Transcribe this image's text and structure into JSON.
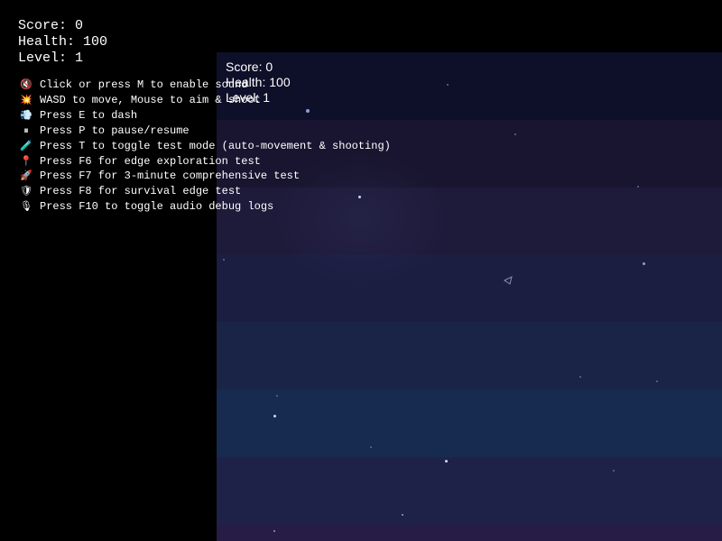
{
  "hud": {
    "score_label": "Score: 0",
    "health_label": "Health: 100",
    "level_label": "Level: 1"
  },
  "canvas_hud": {
    "score_label": "Score: 0",
    "health_label": "Health: 100",
    "level_label": "Level: 1"
  },
  "instructions": [
    {
      "icon": "speaker-muted-icon",
      "glyph": "🔇",
      "text": "Click or press M to enable sound"
    },
    {
      "icon": "sparkle-icon",
      "glyph": "💥",
      "text": "WASD to move, Mouse to aim & shoot"
    },
    {
      "icon": "dash-icon",
      "glyph": "💨",
      "text": "Press E to dash"
    },
    {
      "icon": "pause-icon",
      "glyph": "⏸",
      "text": "Press P to pause/resume"
    },
    {
      "icon": "test-tube-icon",
      "glyph": "🧪",
      "text": "Press T to toggle test mode (auto-movement & shooting)"
    },
    {
      "icon": "pin-icon",
      "glyph": "📍",
      "text": "Press F6 for edge exploration test"
    },
    {
      "icon": "rocket-icon",
      "glyph": "🚀",
      "text": "Press F7 for 3-minute comprehensive test"
    },
    {
      "icon": "shield-icon",
      "glyph": "🛡",
      "text": "Press F8 for survival edge test"
    },
    {
      "icon": "mic-icon",
      "glyph": "🎙",
      "text": "Press F10 to toggle audio debug logs"
    }
  ],
  "colors": {
    "background": "#000000",
    "text": "#ffffff",
    "canvas_top": "#0e0f29",
    "canvas_mid": "#1a2447",
    "canvas_bottom": "#261c45"
  }
}
